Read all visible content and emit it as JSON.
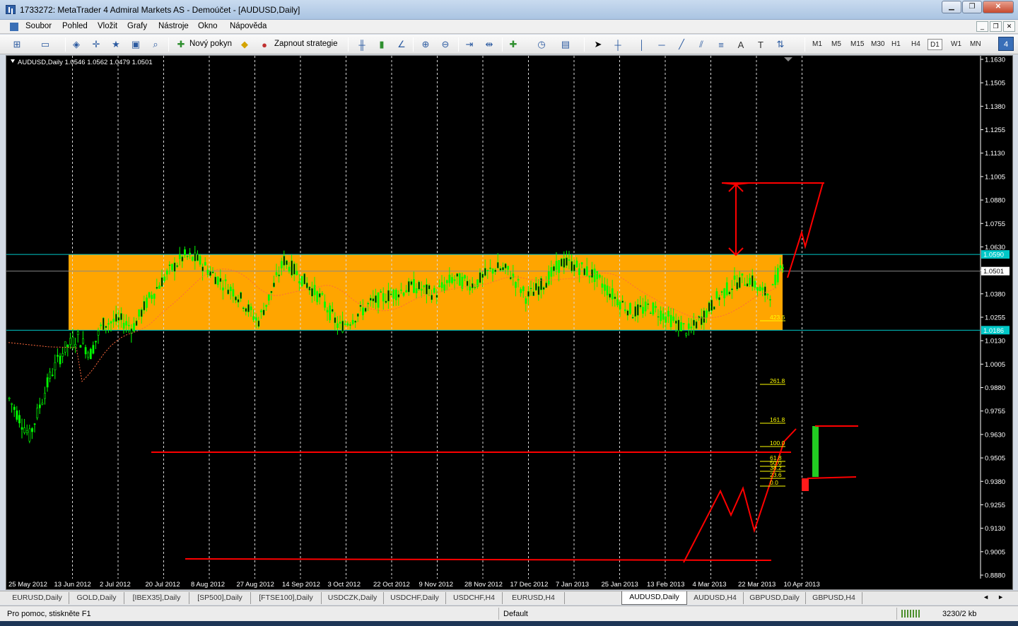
{
  "window": {
    "title": "1733272: MetaTrader 4 Admiral Markets AS - Demoúčet - [AUDUSD,Daily]"
  },
  "menu": [
    "Soubor",
    "Pohled",
    "Vložit",
    "Grafy",
    "Nástroje",
    "Okno",
    "Nápověda"
  ],
  "toolbar": {
    "new_order_label": "Nový pokyn",
    "strategies_label": "Zapnout strategie",
    "timeframes": [
      "M1",
      "M5",
      "M15",
      "M30",
      "H1",
      "H4",
      "D1",
      "W1",
      "MN"
    ],
    "active_timeframe": "D1",
    "right_badge": "4"
  },
  "chart": {
    "info": "AUDUSD,Daily  1.0546 1.0562 1.0479 1.0501",
    "colors": {
      "background": "#000000",
      "candles": "#00ff00",
      "zone": "#ffa500",
      "drawings": "#ff0000",
      "hlines": "#00c8c8",
      "fib": "#ffff00",
      "ma": "#ff6a3d"
    },
    "price_axis": [
      "1.1630",
      "1.1505",
      "1.1380",
      "1.1255",
      "1.1130",
      "1.1005",
      "1.0880",
      "1.0755",
      "1.0630",
      "1.0505",
      "1.0380",
      "1.0255",
      "1.0130",
      "1.0005",
      "0.9880",
      "0.9755",
      "0.9630",
      "0.9505",
      "0.9380",
      "0.9255",
      "0.9130",
      "0.9005",
      "0.8880"
    ],
    "price_labels": {
      "upper_line": "1.0590",
      "current": "1.0501",
      "lower_line": "1.0186"
    },
    "date_axis": [
      "25 May 2012",
      "13 Jun 2012",
      "2 Jul 2012",
      "20 Jul 2012",
      "8 Aug 2012",
      "27 Aug 2012",
      "14 Sep 2012",
      "3 Oct 2012",
      "22 Oct 2012",
      "9 Nov 2012",
      "28 Nov 2012",
      "17 Dec 2012",
      "7 Jan 2013",
      "25 Jan 2013",
      "13 Feb 2013",
      "4 Mar 2013",
      "22 Mar 2013",
      "10 Apr 2013"
    ],
    "fib_levels": [
      "423.6",
      "261.8",
      "161.8",
      "100.0",
      "61.8",
      "50.0",
      "38.2",
      "23.6",
      "0.0"
    ]
  },
  "tabs": [
    "EURUSD,Daily",
    "GOLD,Daily",
    "[IBEX35],Daily",
    "[SP500],Daily",
    "[FTSE100],Daily",
    "USDCZK,Daily",
    "USDCHF,Daily",
    "USDCHF,H4",
    "EURUSD,H4",
    "AUDUSD,Daily",
    "AUDUSD,H4",
    "GBPUSD,Daily",
    "GBPUSD,H4"
  ],
  "active_tab": "AUDUSD,Daily",
  "status": {
    "help": "Pro pomoc, stiskněte F1",
    "profile": "Default",
    "traffic": "3230/2 kb"
  }
}
